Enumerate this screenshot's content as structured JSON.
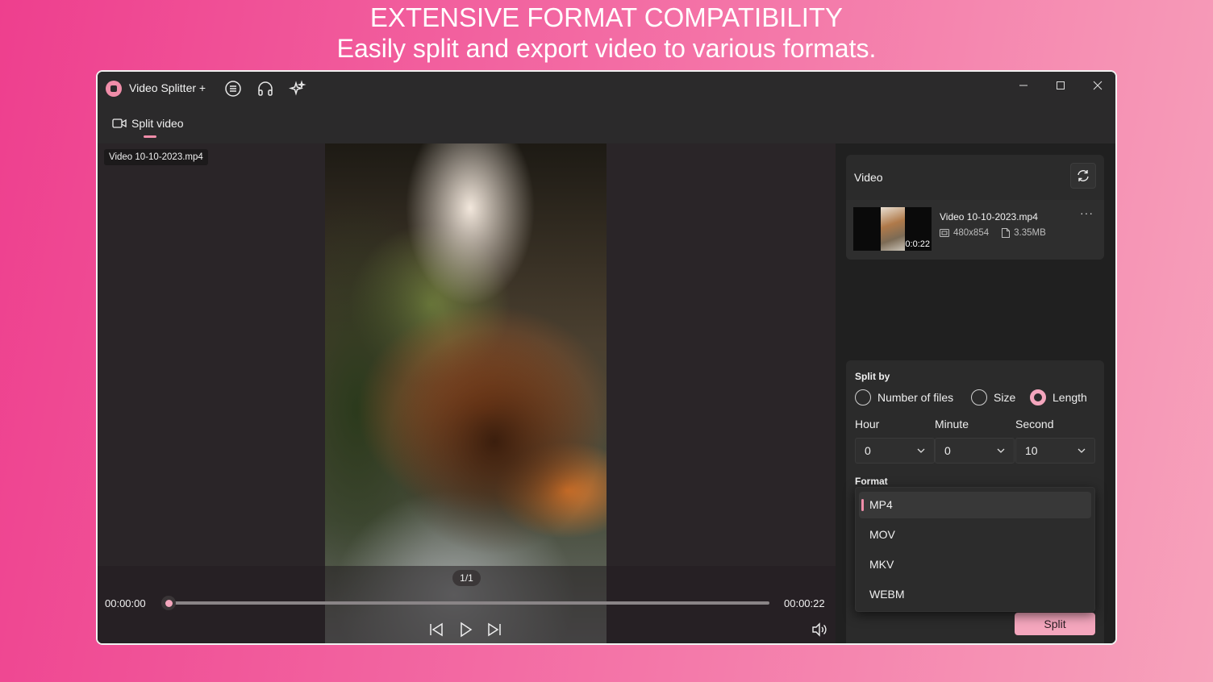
{
  "promo": {
    "headline": "EXTENSIVE FORMAT COMPATIBILITY",
    "subline": "Easily split and export video to various formats."
  },
  "app": {
    "title": "Video Splitter +",
    "tab_label": "Split video"
  },
  "player": {
    "file_name": "Video 10-10-2023.mp4",
    "page_indicator": "1/1",
    "current_time": "00:00:00",
    "total_time": "00:00:22",
    "progress": 0
  },
  "video_panel": {
    "title": "Video",
    "item": {
      "name": "Video 10-10-2023.mp4",
      "duration": "0:0:22",
      "resolution": "480x854",
      "size": "3.35MB",
      "more": "···"
    }
  },
  "split_panel": {
    "split_by_label": "Split by",
    "options": [
      "Number of files",
      "Size",
      "Length"
    ],
    "selected_option": "Length",
    "hour_label": "Hour",
    "minute_label": "Minute",
    "second_label": "Second",
    "hour_value": "0",
    "minute_value": "0",
    "second_value": "10",
    "format_label": "Format",
    "formats": [
      "MP4",
      "MOV",
      "MKV",
      "WEBM"
    ],
    "selected_format": "MP4",
    "split_button": "Split"
  },
  "colors": {
    "accent": "#f4a6bd",
    "window_bg": "#202020",
    "titlebar_bg": "#2b2a2b"
  }
}
